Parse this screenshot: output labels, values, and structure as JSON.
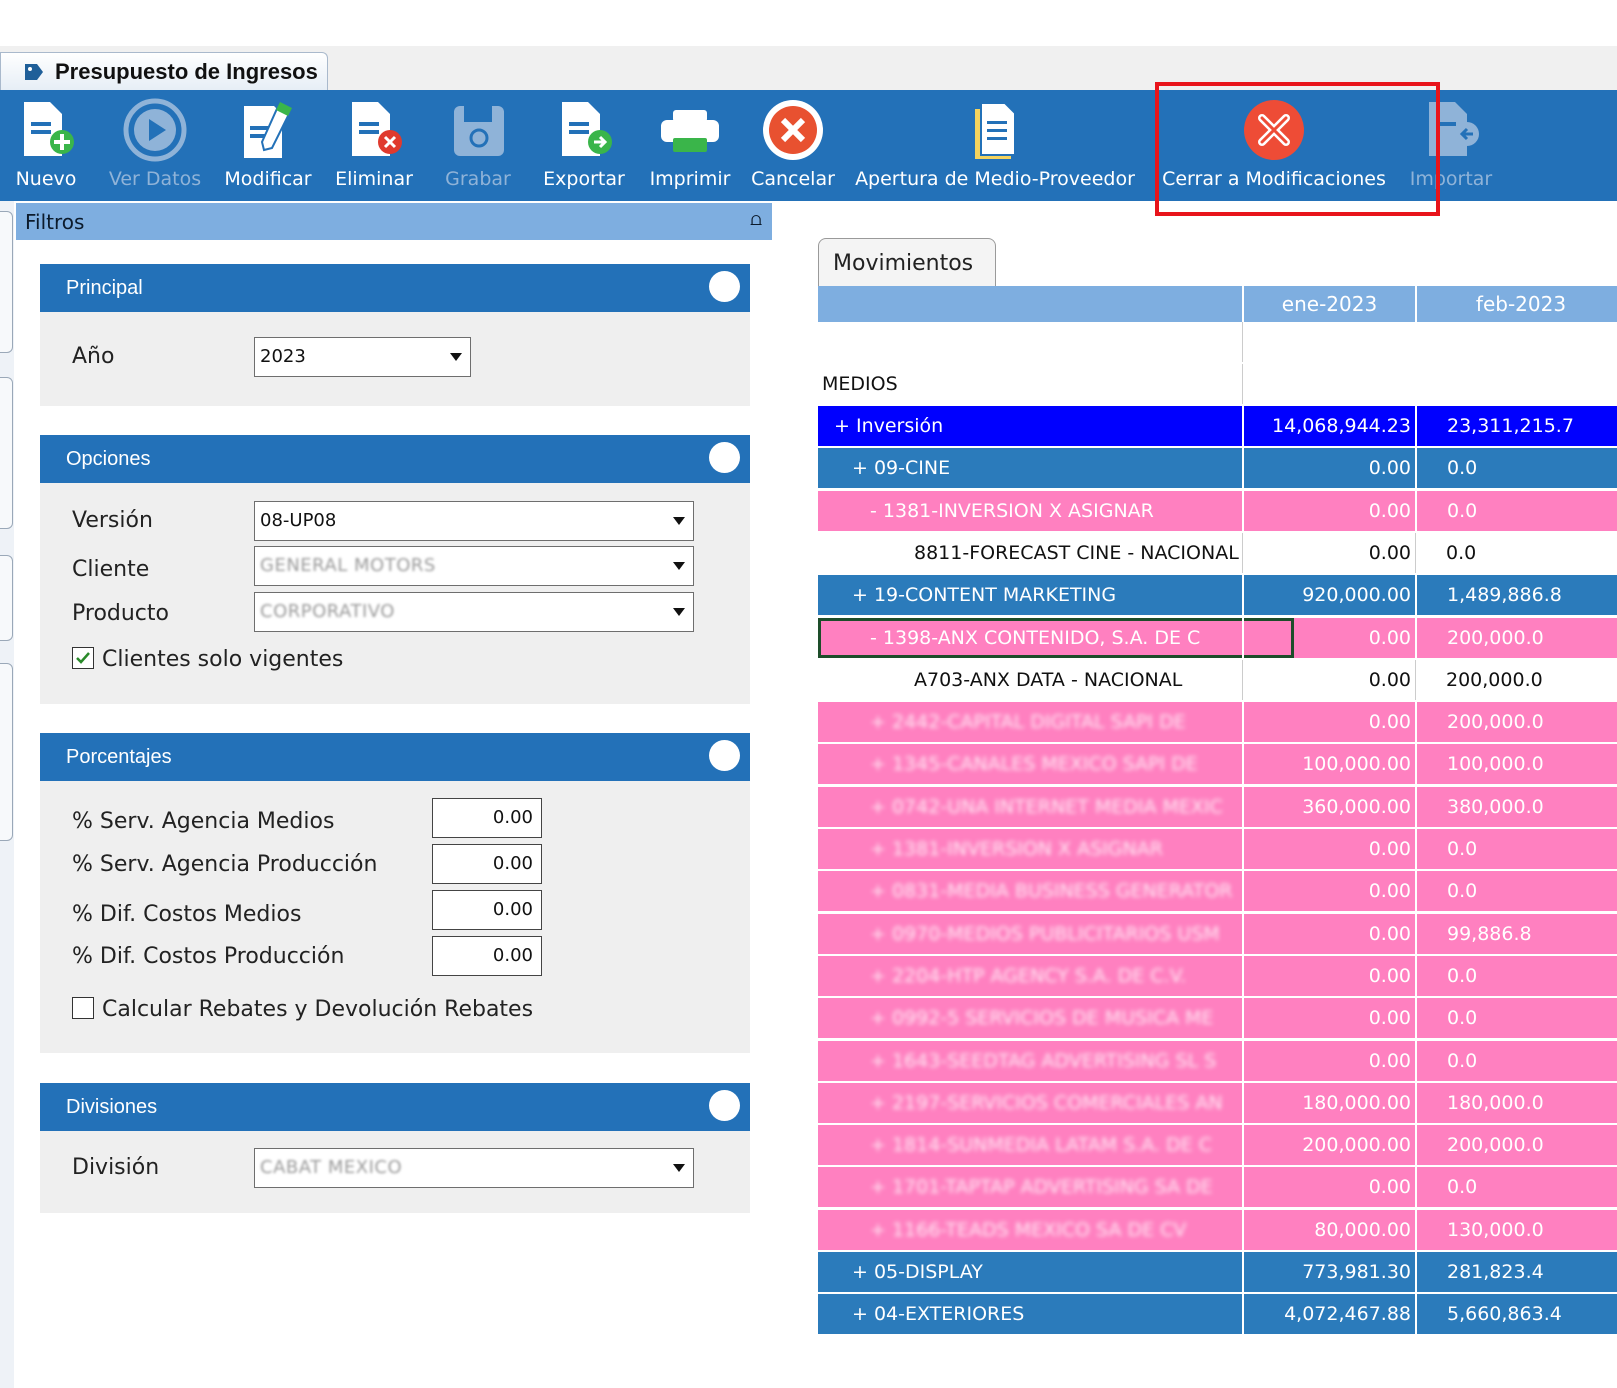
{
  "window": {
    "tab_title": "Presupuesto de Ingresos"
  },
  "toolbar": {
    "items": [
      {
        "label": "Nuevo",
        "icon": "new-document-icon",
        "enabled": true
      },
      {
        "label": "Ver Datos",
        "icon": "play-icon",
        "enabled": false
      },
      {
        "label": "Modificar",
        "icon": "edit-icon",
        "enabled": true
      },
      {
        "label": "Eliminar",
        "icon": "delete-document-icon",
        "enabled": true
      },
      {
        "label": "Grabar",
        "icon": "save-icon",
        "enabled": false
      },
      {
        "label": "Exportar",
        "icon": "export-icon",
        "enabled": true
      },
      {
        "label": "Imprimir",
        "icon": "printer-icon",
        "enabled": true
      },
      {
        "label": "Cancelar",
        "icon": "cancel-icon",
        "enabled": true
      },
      {
        "label": "Apertura de Medio-Proveedor",
        "icon": "document-icon",
        "enabled": true
      },
      {
        "label": "Cerrar a Modificaciones",
        "icon": "close-circle-icon",
        "enabled": true
      },
      {
        "label": "Importar",
        "icon": "import-icon",
        "enabled": false
      }
    ],
    "highlight_color": "#e8141b"
  },
  "filters": {
    "title": "Filtros",
    "pin": "▄",
    "principal": {
      "title": "Principal",
      "year_label": "Año",
      "year_value": "2023"
    },
    "opciones": {
      "title": "Opciones",
      "version_label": "Versión",
      "version_value": "08-UP08",
      "cliente_label": "Cliente",
      "cliente_value": "GENERAL MOTORS",
      "producto_label": "Producto",
      "producto_value": "CORPORATIVO",
      "vigentes_label": "Clientes solo vigentes",
      "vigentes_checked": true
    },
    "porcentajes": {
      "title": "Porcentajes",
      "fields": [
        {
          "label": "% Serv. Agencia Medios",
          "value": "0.00"
        },
        {
          "label": "% Serv. Agencia Producción",
          "value": "0.00"
        },
        {
          "label": "% Dif. Costos Medios",
          "value": "0.00"
        },
        {
          "label": "% Dif. Costos Producción",
          "value": "0.00"
        }
      ],
      "rebates_label": "Calcular Rebates y Devolución Rebates",
      "rebates_checked": false
    },
    "divisiones": {
      "title": "Divisiones",
      "division_label": "División",
      "division_value": "CABAT MEXICO"
    }
  },
  "movimientos": {
    "tab_label": "Movimientos",
    "columns": [
      "ene-2023",
      "feb-2023"
    ],
    "section_label": "MEDIOS",
    "rows": [
      {
        "name": "+  Inversión",
        "v1": "14,068,944.23",
        "v2": "23,311,215.7",
        "style": "blue",
        "indent": 0,
        "blur": false
      },
      {
        "name": "+  09-CINE",
        "v1": "0.00",
        "v2": "0.0",
        "style": "mid",
        "indent": 1,
        "blur": false
      },
      {
        "name": "-  1381-INVERSION X ASIGNAR",
        "v1": "0.00",
        "v2": "0.0",
        "style": "pink",
        "indent": 2,
        "blur": false
      },
      {
        "name": "8811-FORECAST CINE - NACIONAL",
        "v1": "0.00",
        "v2": "0.0",
        "style": "white",
        "indent": 3,
        "blur": false
      },
      {
        "name": "+  19-CONTENT MARKETING",
        "v1": "920,000.00",
        "v2": "1,489,886.8",
        "style": "mid",
        "indent": 1,
        "blur": false
      },
      {
        "name": "-  1398-ANX CONTENIDO, S.A. DE C",
        "v1": "0.00",
        "v2": "200,000.0",
        "style": "pink",
        "indent": 2,
        "blur": false,
        "selected": true
      },
      {
        "name": "A703-ANX DATA - NACIONAL",
        "v1": "0.00",
        "v2": "200,000.0",
        "style": "white",
        "indent": 3,
        "blur": false
      },
      {
        "name": "+  2442-CAPITAL DIGITAL SAPI DE",
        "v1": "0.00",
        "v2": "200,000.0",
        "style": "pink",
        "indent": 2,
        "blur": true
      },
      {
        "name": "+  1345-CANALES MEXICO SAPI DE",
        "v1": "100,000.00",
        "v2": "100,000.0",
        "style": "pink",
        "indent": 2,
        "blur": true
      },
      {
        "name": "+  0742-UNA INTERNET MEDIA MEXIC",
        "v1": "360,000.00",
        "v2": "380,000.0",
        "style": "pink",
        "indent": 2,
        "blur": true
      },
      {
        "name": "+  1381-INVERSION X ASIGNAR",
        "v1": "0.00",
        "v2": "0.0",
        "style": "pink",
        "indent": 2,
        "blur": true
      },
      {
        "name": "+  0831-MEDIA BUSINESS GENERATOR",
        "v1": "0.00",
        "v2": "0.0",
        "style": "pink",
        "indent": 2,
        "blur": true
      },
      {
        "name": "+  0970-MEDIOS PUBLICITARIOS USM",
        "v1": "0.00",
        "v2": "99,886.8",
        "style": "pink",
        "indent": 2,
        "blur": true
      },
      {
        "name": "+  2204-HTP AGENCY S.A. DE C.V.",
        "v1": "0.00",
        "v2": "0.0",
        "style": "pink",
        "indent": 2,
        "blur": true
      },
      {
        "name": "+  0992-5 SERVICIOS DE MUSICA ME",
        "v1": "0.00",
        "v2": "0.0",
        "style": "pink",
        "indent": 2,
        "blur": true
      },
      {
        "name": "+  1643-SEEDTAG ADVERTISING SL S",
        "v1": "0.00",
        "v2": "0.0",
        "style": "pink",
        "indent": 2,
        "blur": true
      },
      {
        "name": "+  2197-SERVICIOS COMERCIALES AN",
        "v1": "180,000.00",
        "v2": "180,000.0",
        "style": "pink",
        "indent": 2,
        "blur": true
      },
      {
        "name": "+  1814-SUNMEDIA LATAM S.A. DE C",
        "v1": "200,000.00",
        "v2": "200,000.0",
        "style": "pink",
        "indent": 2,
        "blur": true
      },
      {
        "name": "+  1701-TAPTAP ADVERTISING SA DE",
        "v1": "0.00",
        "v2": "0.0",
        "style": "pink",
        "indent": 2,
        "blur": true
      },
      {
        "name": "+  1166-TEADS MEXICO SA DE CV",
        "v1": "80,000.00",
        "v2": "130,000.0",
        "style": "pink",
        "indent": 2,
        "blur": true
      },
      {
        "name": "+  05-DISPLAY",
        "v1": "773,981.30",
        "v2": "281,823.4",
        "style": "mid",
        "indent": 1,
        "blur": false
      },
      {
        "name": "+  04-EXTERIORES",
        "v1": "4,072,467.88",
        "v2": "5,660,863.4",
        "style": "mid",
        "indent": 1,
        "blur": false
      }
    ],
    "colors": {
      "inversion": "#0000ff",
      "category": "#2b7bbb",
      "provider": "#ff80c0",
      "header": "#7eaee0"
    }
  }
}
